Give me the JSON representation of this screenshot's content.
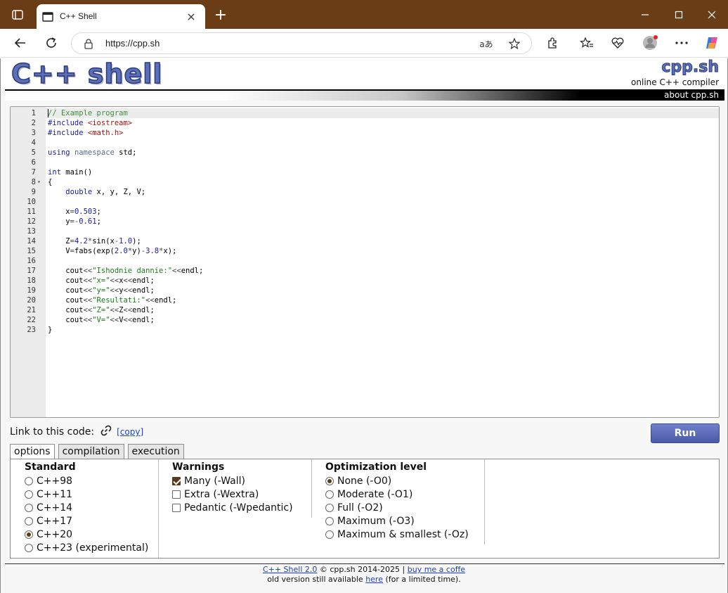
{
  "browser": {
    "tab_title": "C++ Shell",
    "url": "https://cpp.sh",
    "new_tab_symbol": "+",
    "read_aloud_symbol": "aあ"
  },
  "header": {
    "logo": "C++ shell",
    "brand": "cpp.sh",
    "brand_sub": "online C++ compiler",
    "about": "about cpp.sh"
  },
  "editor": {
    "lines": [
      {
        "n": "1",
        "fold": "",
        "active": true,
        "tokens": [
          [
            "cm",
            "// Example program"
          ]
        ]
      },
      {
        "n": "2",
        "fold": "",
        "tokens": [
          [
            "pp",
            "#include "
          ],
          [
            "str",
            "<iostream>"
          ]
        ]
      },
      {
        "n": "3",
        "fold": "",
        "tokens": [
          [
            "pp",
            "#include "
          ],
          [
            "str",
            "<math.h>"
          ]
        ]
      },
      {
        "n": "4",
        "fold": "",
        "tokens": []
      },
      {
        "n": "5",
        "fold": "",
        "tokens": [
          [
            "kw",
            "using"
          ],
          [
            "",
            " "
          ],
          [
            "kw2",
            "namespace"
          ],
          [
            "",
            " std;"
          ]
        ]
      },
      {
        "n": "6",
        "fold": "",
        "tokens": []
      },
      {
        "n": "7",
        "fold": "",
        "tokens": [
          [
            "kw",
            "int"
          ],
          [
            "",
            " main()"
          ]
        ]
      },
      {
        "n": "8",
        "fold": "▾",
        "tokens": [
          [
            "",
            "{"
          ]
        ]
      },
      {
        "n": "9",
        "fold": "",
        "tokens": [
          [
            "",
            "    "
          ],
          [
            "kw",
            "double"
          ],
          [
            "",
            " x, y, Z, V;"
          ]
        ]
      },
      {
        "n": "10",
        "fold": "",
        "tokens": []
      },
      {
        "n": "11",
        "fold": "",
        "tokens": [
          [
            "",
            "    x"
          ],
          [
            "ops",
            "="
          ],
          [
            "num",
            "0.503"
          ],
          [
            "",
            ";"
          ]
        ]
      },
      {
        "n": "12",
        "fold": "",
        "tokens": [
          [
            "",
            "    y"
          ],
          [
            "ops",
            "=-"
          ],
          [
            "num",
            "0.61"
          ],
          [
            "",
            ";"
          ]
        ]
      },
      {
        "n": "13",
        "fold": "",
        "tokens": []
      },
      {
        "n": "14",
        "fold": "",
        "tokens": [
          [
            "",
            "    Z"
          ],
          [
            "ops",
            "="
          ],
          [
            "num",
            "4.2"
          ],
          [
            "ops",
            "*"
          ],
          [
            "",
            "sin(x"
          ],
          [
            "ops",
            "-"
          ],
          [
            "num",
            "1.0"
          ],
          [
            "",
            ");"
          ]
        ]
      },
      {
        "n": "15",
        "fold": "",
        "tokens": [
          [
            "",
            "    V"
          ],
          [
            "ops",
            "="
          ],
          [
            "",
            "fabs(exp("
          ],
          [
            "num",
            "2.0"
          ],
          [
            "ops",
            "*"
          ],
          [
            "",
            "y)"
          ],
          [
            "ops",
            "-"
          ],
          [
            "num",
            "3.8"
          ],
          [
            "ops",
            "*"
          ],
          [
            "",
            "x);"
          ]
        ]
      },
      {
        "n": "16",
        "fold": "",
        "tokens": []
      },
      {
        "n": "17",
        "fold": "",
        "tokens": [
          [
            "",
            "    cout"
          ],
          [
            "ops",
            "<<"
          ],
          [
            "sg",
            "\"Ishodnie dannie:\""
          ],
          [
            "ops",
            "<<"
          ],
          [
            "",
            "endl;"
          ]
        ]
      },
      {
        "n": "18",
        "fold": "",
        "tokens": [
          [
            "",
            "    cout"
          ],
          [
            "ops",
            "<<"
          ],
          [
            "sg",
            "\"x=\""
          ],
          [
            "ops",
            "<<"
          ],
          [
            "",
            "x"
          ],
          [
            "ops",
            "<<"
          ],
          [
            "",
            "endl;"
          ]
        ]
      },
      {
        "n": "19",
        "fold": "",
        "tokens": [
          [
            "",
            "    cout"
          ],
          [
            "ops",
            "<<"
          ],
          [
            "sg",
            "\"y=\""
          ],
          [
            "ops",
            "<<"
          ],
          [
            "",
            "y"
          ],
          [
            "ops",
            "<<"
          ],
          [
            "",
            "endl;"
          ]
        ]
      },
      {
        "n": "20",
        "fold": "",
        "tokens": [
          [
            "",
            "    cout"
          ],
          [
            "ops",
            "<<"
          ],
          [
            "sg",
            "\"Resultati:\""
          ],
          [
            "ops",
            "<<"
          ],
          [
            "",
            "endl;"
          ]
        ]
      },
      {
        "n": "21",
        "fold": "",
        "tokens": [
          [
            "",
            "    cout"
          ],
          [
            "ops",
            "<<"
          ],
          [
            "sg",
            "\"Z=\""
          ],
          [
            "ops",
            "<<"
          ],
          [
            "",
            "Z"
          ],
          [
            "ops",
            "<<"
          ],
          [
            "",
            "endl;"
          ]
        ]
      },
      {
        "n": "22",
        "fold": "",
        "tokens": [
          [
            "",
            "    cout"
          ],
          [
            "ops",
            "<<"
          ],
          [
            "sg",
            "\"V=\""
          ],
          [
            "ops",
            "<<"
          ],
          [
            "",
            "V"
          ],
          [
            "ops",
            "<<"
          ],
          [
            "",
            "endl;"
          ]
        ]
      },
      {
        "n": "23",
        "fold": "",
        "tokens": [
          [
            "",
            "}"
          ]
        ]
      }
    ]
  },
  "link": {
    "label": "Link to this code:",
    "copy": "[copy]"
  },
  "run_label": "Run",
  "tabs": [
    "options",
    "compilation",
    "execution"
  ],
  "options": {
    "standard": {
      "title": "Standard",
      "items": [
        {
          "label": "C++98",
          "checked": false
        },
        {
          "label": "C++11",
          "checked": false
        },
        {
          "label": "C++14",
          "checked": false
        },
        {
          "label": "C++17",
          "checked": false
        },
        {
          "label": "C++20",
          "checked": true
        },
        {
          "label": "C++23 (experimental)",
          "checked": false
        }
      ]
    },
    "warnings": {
      "title": "Warnings",
      "items": [
        {
          "label": "Many (-Wall)",
          "checked": true
        },
        {
          "label": "Extra (-Wextra)",
          "checked": false
        },
        {
          "label": "Pedantic (-Wpedantic)",
          "checked": false
        }
      ]
    },
    "optimization": {
      "title": "Optimization level",
      "items": [
        {
          "label": "None (-O0)",
          "checked": true
        },
        {
          "label": "Moderate (-O1)",
          "checked": false
        },
        {
          "label": "Full (-O2)",
          "checked": false
        },
        {
          "label": "Maximum (-O3)",
          "checked": false
        },
        {
          "label": "Maximum & smallest (-Oz)",
          "checked": false
        }
      ]
    }
  },
  "footer": {
    "shell_link": "C++ Shell 2.0",
    "copyright": " © cpp.sh 2014-2025 | ",
    "coffee_link": "buy me a coffe",
    "old_prefix": "old version still available ",
    "here_link": "here",
    "old_suffix": " (for a limited time)."
  },
  "colors": {
    "titlebar": "#6b3d16",
    "accent": "#5c6fb9",
    "run_button": "#4b5aa8",
    "link": "#1a3fd0"
  }
}
